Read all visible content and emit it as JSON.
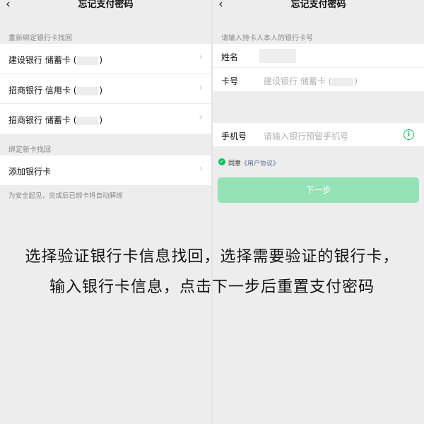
{
  "left": {
    "title": "忘记支付密码",
    "back_icon": "chevron-left-icon",
    "section1_label": "重新绑定银行卡找回",
    "cards": [
      {
        "bank": "建设银行",
        "type": "储蓄卡",
        "paren_open": "(",
        "paren_close": ")"
      },
      {
        "bank": "招商银行",
        "type": "信用卡",
        "paren_open": "(",
        "paren_close": ")"
      },
      {
        "bank": "招商银行",
        "type": "储蓄卡",
        "paren_open": "(",
        "paren_close": ")"
      }
    ],
    "section2_label": "绑定新卡找回",
    "add_card_label": "添加银行卡",
    "footer_hint": "为安全起见，完成后已绑卡将自动解绑"
  },
  "right": {
    "title": "忘记支付密码",
    "back_icon": "chevron-left-icon",
    "section_label": "请输入持卡人本人的银行卡号",
    "name_label": "姓名",
    "card_label": "卡号",
    "card_value_bank": "建设银行",
    "card_value_type": "储蓄卡",
    "card_value_paren_open": "(",
    "card_value_paren_close": ")",
    "phone_label": "手机号",
    "phone_placeholder": "请输入银行预留手机号",
    "agree_prefix": "同意",
    "agree_link": "《用户协议》",
    "next_button": "下一步"
  },
  "caption": {
    "line1": "选择验证银行卡信息找回，选择需要验证的银行卡，",
    "line2": "输入银行卡信息，点击下一步后重置支付密码"
  },
  "colors": {
    "accent": "#07c160",
    "button_disabled": "#95e2b7",
    "link": "#576b95",
    "background": "#ededed"
  }
}
